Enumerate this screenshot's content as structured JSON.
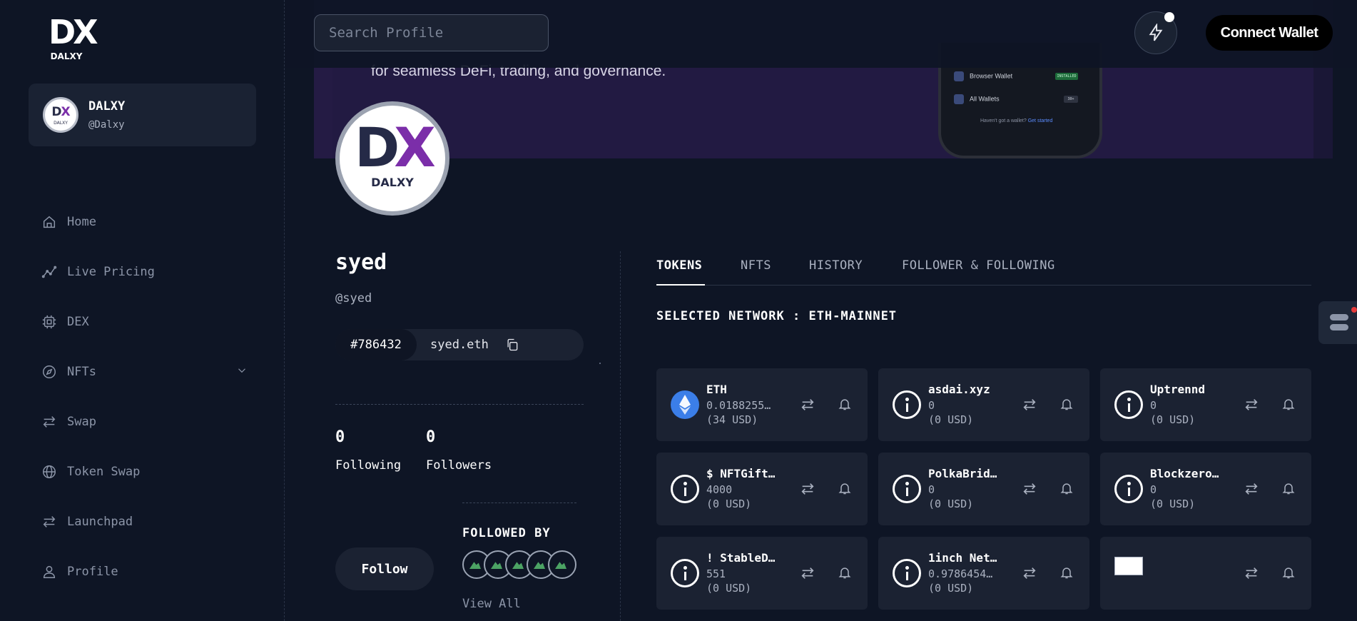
{
  "brand": {
    "logo_mark": "DX",
    "logo_text": "DALXY"
  },
  "profile_card": {
    "name": "DALXY",
    "handle": "@Dalxy"
  },
  "sidebar": {
    "items": [
      {
        "label": "Home",
        "icon": "home-icon"
      },
      {
        "label": "Live Pricing",
        "icon": "chart-line-icon"
      },
      {
        "label": "DEX",
        "icon": "chip-icon"
      },
      {
        "label": "NFTs",
        "icon": "compass-icon"
      },
      {
        "label": "Swap",
        "icon": "swap-icon"
      },
      {
        "label": "Token Swap",
        "icon": "globe-icon"
      },
      {
        "label": "Launchpad",
        "icon": "swap-icon"
      },
      {
        "label": "Profile",
        "icon": "user-icon"
      }
    ]
  },
  "header": {
    "search_placeholder": "Search Profile",
    "connect_label": "Connect Wallet"
  },
  "banner": {
    "text": "for seamless DeFi, trading, and governance.",
    "phone": {
      "row1": "Browser Wallet",
      "row1_tag": "INSTALLED",
      "row2": "All Wallets",
      "row2_tag": "30+",
      "footer": "Haven't got a wallet?",
      "footer_link": "Get started"
    }
  },
  "user": {
    "name": "syed",
    "handle": "@syed",
    "id": "#786432",
    "ens": "syed.eth",
    "following_count": "0",
    "following_label": "Following",
    "followers_count": "0",
    "followers_label": "Followers",
    "follow_label": "Follow",
    "followed_by_label": "FOLLOWED BY",
    "view_all_label": "View All"
  },
  "tabs": [
    {
      "label": "TOKENS",
      "active": true
    },
    {
      "label": "NFTS"
    },
    {
      "label": "HISTORY"
    },
    {
      "label": "FOLLOWER & FOLLOWING"
    }
  ],
  "network_label": "SELECTED NETWORK : ETH-MAINNET",
  "tokens": [
    {
      "name": "ETH",
      "amount": "0.0188255…",
      "usd": "(34 USD)",
      "icon": "eth-icon"
    },
    {
      "name": "asdai.xyz",
      "amount": "0",
      "usd": "(0 USD)",
      "icon": "info-icon"
    },
    {
      "name": "Uptrennd",
      "amount": "0",
      "usd": "(0 USD)",
      "icon": "info-icon"
    },
    {
      "name": "$ NFTGift…",
      "amount": "4000",
      "usd": "(0 USD)",
      "icon": "info-icon"
    },
    {
      "name": "PolkaBrid…",
      "amount": "0",
      "usd": "(0 USD)",
      "icon": "info-icon"
    },
    {
      "name": "Blockzero…",
      "amount": "0",
      "usd": "(0 USD)",
      "icon": "info-icon"
    },
    {
      "name": "! StableD…",
      "amount": "551",
      "usd": "(0 USD)",
      "icon": "info-icon"
    },
    {
      "name": "1inch Net…",
      "amount": "0.9786454…",
      "usd": "(0 USD)",
      "icon": "info-icon"
    },
    {
      "name": "",
      "amount": "",
      "usd": "",
      "icon": "broken-image-icon"
    }
  ]
}
